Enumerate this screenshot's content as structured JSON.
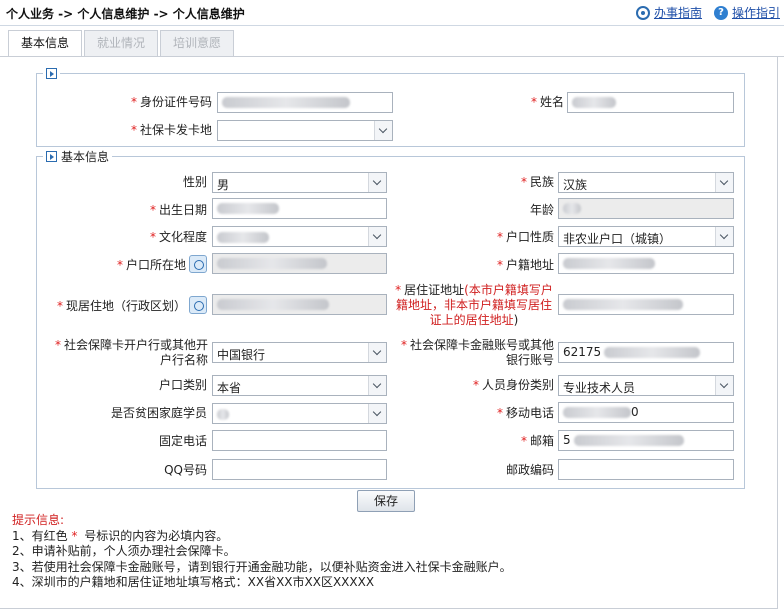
{
  "header": {
    "breadcrumb": "个人业务 -> 个人信息维护 -> 个人信息维护",
    "guide_link": "办事指南",
    "help_link": "操作指引"
  },
  "tabs": [
    {
      "label": "基本信息",
      "active": true
    },
    {
      "label": "就业情况",
      "active": false
    },
    {
      "label": "培训意愿",
      "active": false
    }
  ],
  "card_group": {
    "id_label": "身份证件号码",
    "name_label": "姓名",
    "card_city_label": "社保卡发卡地",
    "card_city_value": ""
  },
  "basic_group": {
    "legend": "基本信息",
    "gender_label": "性别",
    "gender_value": "男",
    "ethnic_label": "民族",
    "ethnic_value": "汉族",
    "birth_label": "出生日期",
    "age_label": "年龄",
    "education_label": "文化程度",
    "hukou_type_label": "户口性质",
    "hukou_type_value": "非农业户口（城镇）",
    "hukou_place_label": "户口所在地",
    "hukou_addr_label": "户籍地址",
    "residence_label": "现居住地（行政区划）",
    "permit_addr_label": "居住证地址",
    "permit_addr_note_1": "(本市户籍填写户",
    "permit_addr_note_2": "籍地址，非本市户籍填写居住",
    "permit_addr_note_3": "证上的居住地址",
    "permit_addr_note_4": ")",
    "bank_label_1": "社会保障卡开户行或其他开",
    "bank_label_2": "户行名称",
    "bank_value": "中国银行",
    "account_label_1": "社会保障卡金融账号或其他",
    "account_label_2": "银行账号",
    "account_value": "62175",
    "hukou_cat_label": "户口类别",
    "hukou_cat_value": "本省",
    "identity_label": "人员身份类别",
    "identity_value": "专业技术人员",
    "poor_label": "是否贫困家庭学员",
    "poor_value": "",
    "mobile_label": "移动电话",
    "mobile_tail": "0",
    "phone_label": "固定电话",
    "phone_value": "",
    "email_label": "邮箱",
    "email_value": "5",
    "qq_label": "QQ号码",
    "qq_value": "",
    "zip_label": "邮政编码",
    "zip_value": ""
  },
  "save_button": "保存",
  "tips": {
    "title": "提示信息:",
    "line1_a": "1、有红色 ",
    "line1_star": "*",
    "line1_b": " 号标识的内容为必填内容。",
    "line2": "2、申请补贴前，个人须办理社会保障卡。",
    "line3": "3、若使用社会保障卡金融账号，请到银行开通金融功能，以便补贴资金进入社保卡金融账户。",
    "line4": "4、深圳市的户籍地和居住证地址填写格式：XX省XX市XX区XXXXX"
  },
  "colors": {
    "required": "#e02020",
    "link": "#1f4fa8",
    "border": "#b8c7d9"
  }
}
